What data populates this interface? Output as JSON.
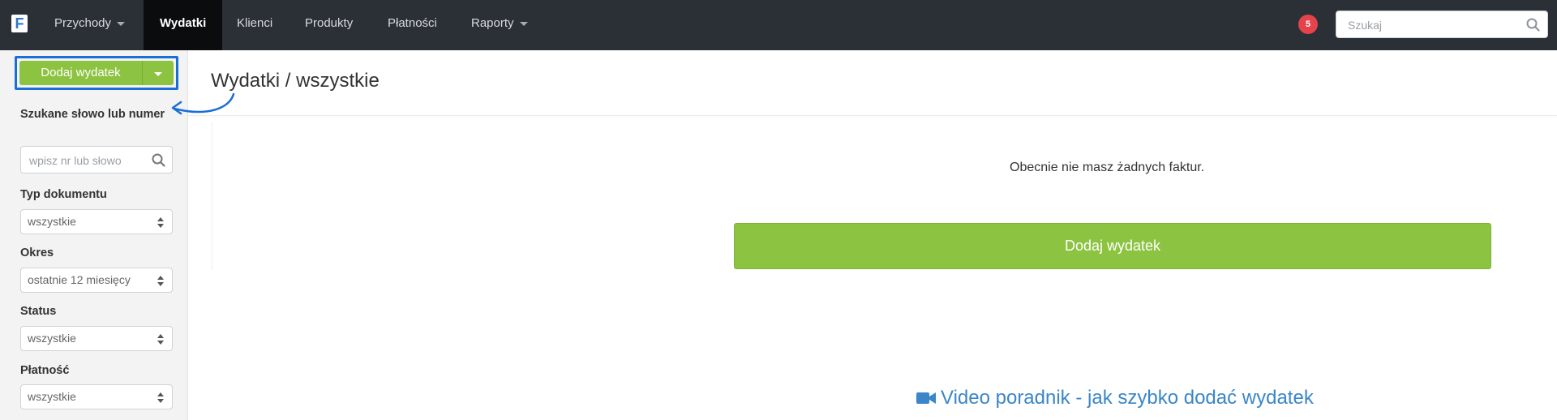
{
  "app": {
    "logo_letter": "F"
  },
  "nav": {
    "items": [
      {
        "label": "Przychody",
        "dropdown": true,
        "active": false
      },
      {
        "label": "Wydatki",
        "dropdown": false,
        "active": true
      },
      {
        "label": "Klienci",
        "dropdown": false,
        "active": false
      },
      {
        "label": "Produkty",
        "dropdown": false,
        "active": false
      },
      {
        "label": "Płatności",
        "dropdown": false,
        "active": false
      },
      {
        "label": "Raporty",
        "dropdown": true,
        "active": false
      }
    ],
    "notification_count": "5",
    "search_placeholder": "Szukaj"
  },
  "sidebar": {
    "add_button_label": "Dodaj wydatek",
    "filters": {
      "search_label": "Szukane słowo lub numer",
      "search_placeholder": "wpisz nr lub słowo",
      "doc_type_label": "Typ dokumentu",
      "doc_type_value": "wszystkie",
      "period_label": "Okres",
      "period_value": "ostatnie 12 miesięcy",
      "status_label": "Status",
      "status_value": "wszystkie",
      "payment_label": "Płatność",
      "payment_value": "wszystkie"
    }
  },
  "main": {
    "page_title": "Wydatki / wszystkie",
    "empty_message": "Obecnie nie masz żadnych faktur.",
    "add_button_label": "Dodaj wydatek",
    "video_link_label": "Video poradnik - jak szybko dodać wydatek"
  },
  "colors": {
    "navbar_bg": "#2b2f36",
    "accent_green": "#8cc340",
    "highlight_blue": "#1a6fd6",
    "link_blue": "#3a86c8",
    "badge_red": "#e4434b"
  }
}
